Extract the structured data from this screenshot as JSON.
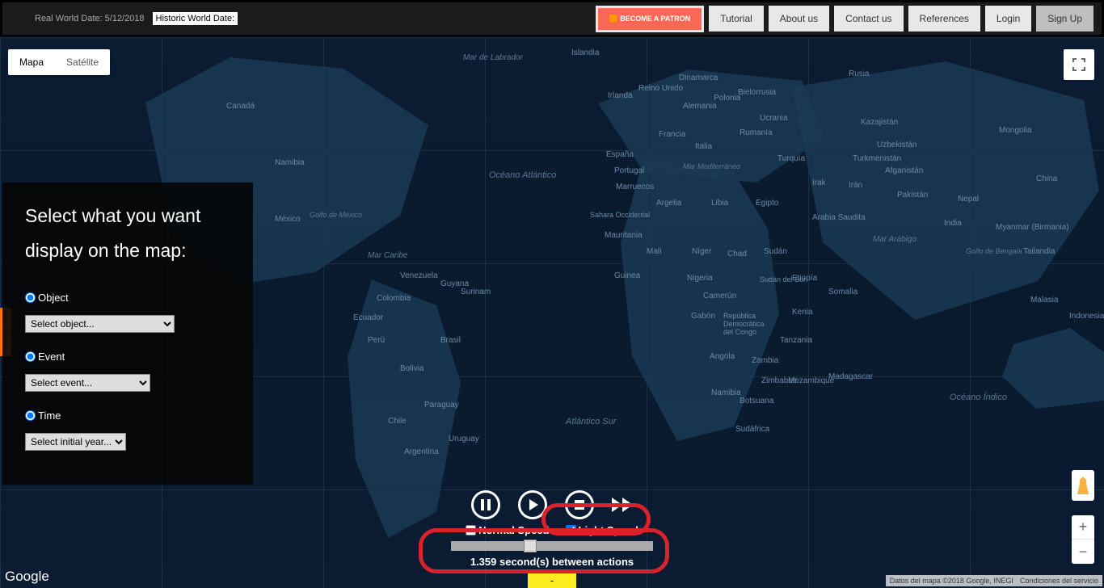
{
  "topbar": {
    "real_date_label": "Real World Date: 5/12/2018",
    "historic_label": "Historic World Date:",
    "patron": "BECOME A PATRON",
    "nav": [
      "Tutorial",
      "About us",
      "Contact us",
      "References",
      "Login",
      "Sign Up"
    ]
  },
  "map_type": {
    "map": "Mapa",
    "sat": "Satélite"
  },
  "sidebar": {
    "title": "Select what you want display on the map:",
    "object_label": "Object",
    "object_select": "Select object...",
    "event_label": "Event",
    "event_select": "Select event...",
    "time_label": "Time",
    "time_select": "Select initial year...",
    "collapse": "-"
  },
  "labels": {
    "na": "Namibia",
    "mx": "México",
    "ca": "Canadá",
    "br": "Brasil",
    "ar": "Argentina",
    "co": "Colombia",
    "ve": "Venezuela",
    "pe": "Perú",
    "cl": "Chile",
    "bo": "Bolivia",
    "py": "Paraguay",
    "uy": "Uruguay",
    "ec": "Ecuador",
    "gy": "Guyana",
    "sr": "Surinam",
    "es": "España",
    "fr": "Francia",
    "it": "Italia",
    "de": "Alemania",
    "pl": "Polonia",
    "ua": "Ucrania",
    "ro": "Rumanía",
    "by": "Bielorrusia",
    "uk": "Reino Unido",
    "ie": "Irlanda",
    "pt": "Portugal",
    "dk": "Dinamarca",
    "is": "Islandia",
    "ru": "Rusia",
    "kz": "Kazajistán",
    "tr": "Turquía",
    "ir": "Irán",
    "iq": "Irak",
    "sa": "Arabia Saudita",
    "af": "Afganistán",
    "pk": "Pakistán",
    "in": "India",
    "cn": "China",
    "mn": "Mongolia",
    "uz": "Uzbekistán",
    "tm": "Turkmenistán",
    "np": "Nepal",
    "mm": "Myanmar (Birmania)",
    "th": "Tailandia",
    "my": "Malasia",
    "id": "Indonesia",
    "eg": "Egipto",
    "ly": "Libia",
    "dz": "Argelia",
    "ma": "Marruecos",
    "mr": "Mauritania",
    "ml": "Malí",
    "ne": "Níger",
    "td": "Chad",
    "sd": "Sudán",
    "et": "Etiopía",
    "so": "Somalia",
    "ke": "Kenia",
    "tz": "Tanzania",
    "cd": "República Democrática del Congo",
    "ao": "Angola",
    "zm": "Zambia",
    "zw": "Zimbabue",
    "za": "Sudáfrica",
    "mg": "Madagascar",
    "mz": "Mozambique",
    "ng": "Nigeria",
    "gn": "Guinea",
    "cm": "Camerún",
    "ga": "Gabón",
    "bw": "Botsuana",
    "so2": "Sahara Occidental",
    "ss": "Sudán del Sur",
    "ao_ocean": "Océano Atlántico",
    "as_ocean": "Atlántico Sur",
    "io_ocean": "Océano Índico",
    "lab": "Mar de Labrador",
    "med": "Mar Mediterráneo",
    "arab": "Mar Arábigo",
    "beng": "Golfo de Bengala",
    "carib": "Mar Caribe",
    "gom": "Golfo de México"
  },
  "player": {
    "normal": "Normal Speed",
    "light": "Light Speed",
    "slider_text": "1.359 second(s) between actions"
  },
  "footer": {
    "google": "Google",
    "attrib1": "Datos del mapa ©2018 Google, INEGI",
    "attrib2": "Condiciones del servicio",
    "yellow": "-"
  }
}
